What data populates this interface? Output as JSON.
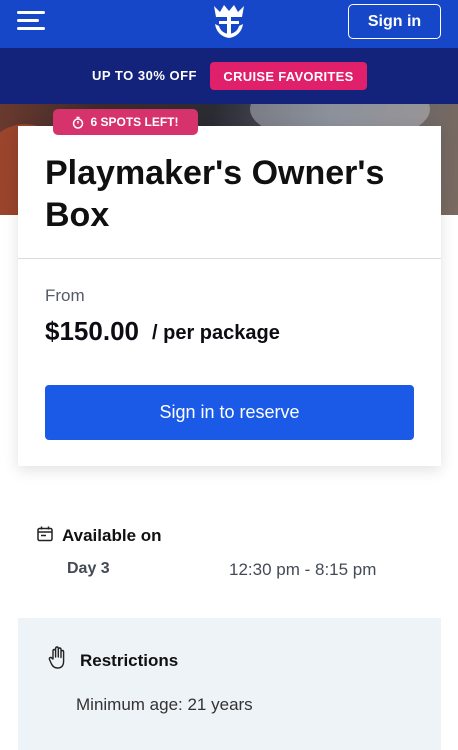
{
  "header": {
    "menu_icon": "hamburger-menu-icon",
    "logo_icon": "crown-anchor-logo-icon",
    "sign_in_label": "Sign in",
    "background_color": "#1647c8"
  },
  "promo": {
    "discount_text": "UP TO 30% OFF",
    "tag_label": "CRUISE FAVORITES",
    "tag_color": "#e0206a",
    "background_color": "#13227a"
  },
  "product": {
    "spots_label": "6 SPOTS LEFT!",
    "spots_icon": "timer-icon",
    "spots_color": "#d6336c",
    "title": "Playmaker's Owner's Box",
    "from_label": "From",
    "price": "$150.00",
    "price_unit": "/ per package",
    "reserve_label": "Sign in to reserve",
    "accent_color": "#1a5ae6"
  },
  "availability": {
    "icon": "calendar-icon",
    "title": "Available on",
    "day": "Day 3",
    "time": "12:30 pm - 8:15 pm"
  },
  "restrictions": {
    "icon": "hand-stop-icon",
    "title": "Restrictions",
    "text": "Minimum age: 21 years"
  }
}
